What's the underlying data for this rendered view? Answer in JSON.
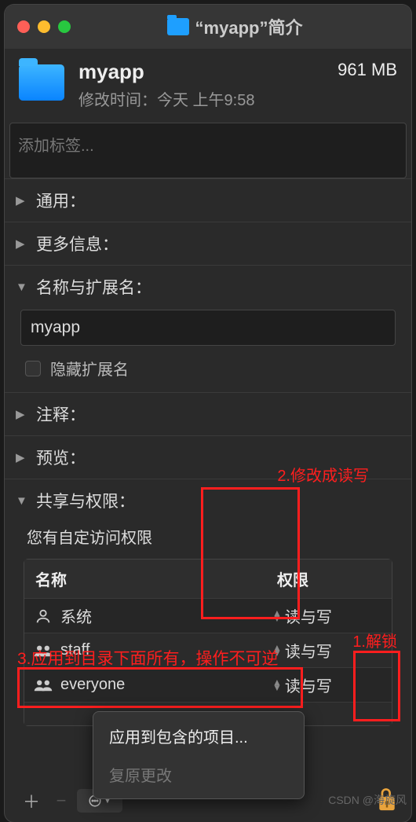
{
  "titlebar": {
    "title": "“myapp”简介"
  },
  "header": {
    "name": "myapp",
    "size": "961 MB",
    "modified_label": "修改时间：",
    "modified_value": "今天 上午9:58"
  },
  "tags": {
    "placeholder": "添加标签..."
  },
  "sections": {
    "general": "通用：",
    "more_info": "更多信息：",
    "name_ext": "名称与扩展名：",
    "comments": "注释：",
    "preview": "预览：",
    "sharing": "共享与权限："
  },
  "name_ext": {
    "value": "myapp",
    "hide_ext": "隐藏扩展名"
  },
  "permissions": {
    "message": "您有自定访问权限",
    "col_name": "名称",
    "col_priv": "权限",
    "rows": [
      {
        "name": "系统",
        "priv": "读与写"
      },
      {
        "name": "staff",
        "priv": "读与写"
      },
      {
        "name": "everyone",
        "priv": "读与写"
      }
    ]
  },
  "menu": {
    "apply": "应用到包含的项目...",
    "revert": "复原更改"
  },
  "annotations": {
    "a1": "1.解锁",
    "a2": "2.修改成读写",
    "a3": "3.应用到目录下面所有，操作不可逆"
  },
  "watermark": "CSDN @海旋风"
}
